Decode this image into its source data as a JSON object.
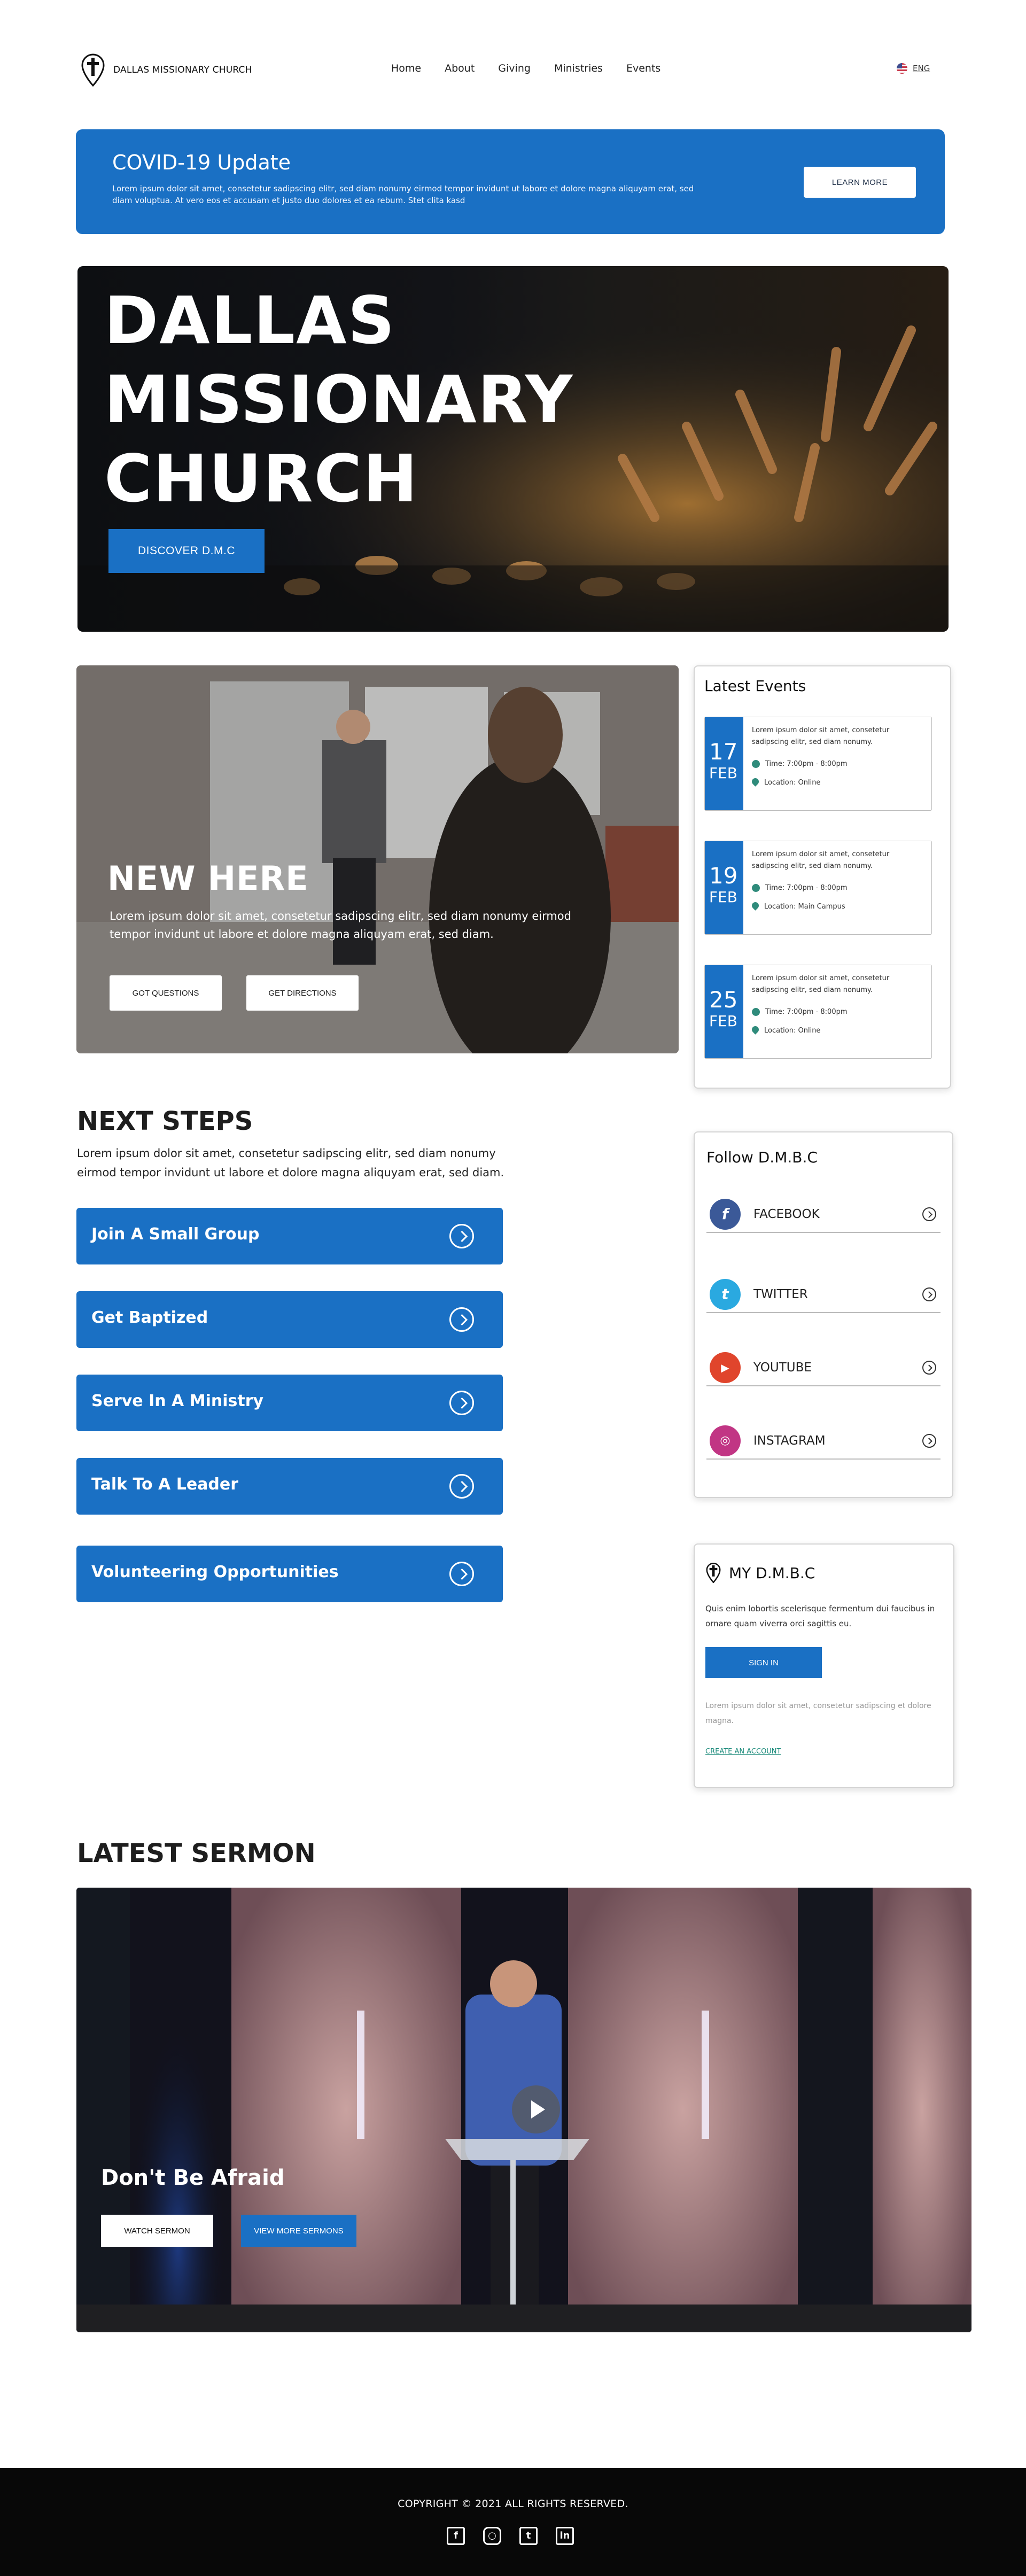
{
  "header": {
    "logo_text": "DALLAS MISSIONARY CHURCH",
    "nav": [
      "Home",
      "About",
      "Giving",
      "Ministries",
      "Events"
    ],
    "language": "ENG"
  },
  "covid": {
    "title": "COVID-19 Update",
    "text": "Lorem ipsum dolor sit amet, consetetur sadipscing elitr, sed diam nonumy eirmod tempor invidunt ut labore et dolore magna aliquyam erat, sed diam voluptua. At vero eos et accusam et justo duo dolores et ea rebum. Stet clita kasd",
    "button": "LEARN MORE"
  },
  "hero": {
    "title_lines": [
      "DALLAS",
      "MISSIONARY",
      "CHURCH"
    ],
    "button": "DISCOVER D.M.C"
  },
  "new_here": {
    "title": "NEW HERE",
    "text": "Lorem ipsum dolor sit amet, consetetur sadipscing elitr, sed diam nonumy eirmod tempor invidunt ut labore et dolore magna aliquyam erat, sed diam.",
    "btn_questions": "GOT QUESTIONS",
    "btn_directions": "GET DIRECTIONS"
  },
  "events": {
    "title": "Latest Events",
    "items": [
      {
        "day": "17",
        "month": "FEB",
        "desc": "Lorem ipsum dolor sit amet, consetetur sadipscing elitr, sed diam nonumy.",
        "time": "Time: 7:00pm - 8:00pm",
        "location": "Location: Online"
      },
      {
        "day": "19",
        "month": "FEB",
        "desc": "Lorem ipsum dolor sit amet, consetetur sadipscing elitr, sed diam nonumy.",
        "time": "Time: 7:00pm - 8:00pm",
        "location": "Location: Main Campus"
      },
      {
        "day": "25",
        "month": "FEB",
        "desc": "Lorem ipsum dolor sit amet, consetetur sadipscing elitr, sed diam nonumy.",
        "time": "Time: 7:00pm - 8:00pm",
        "location": "Location: Online"
      }
    ]
  },
  "next_steps": {
    "title": "NEXT STEPS",
    "text": "Lorem ipsum dolor sit amet, consetetur sadipscing elitr, sed diam nonumy eirmod tempor invidunt ut labore et dolore magna aliquyam erat, sed diam.",
    "items": [
      "Join A Small Group",
      "Get Baptized",
      "Serve In A Ministry",
      "Talk To A Leader",
      "Volunteering Opportunities"
    ]
  },
  "follow": {
    "title": "Follow D.M.B.C",
    "items": [
      {
        "label": "FACEBOOK",
        "icon": "facebook-icon",
        "color": "#3b5998"
      },
      {
        "label": "TWITTER",
        "icon": "twitter-icon",
        "color": "#2aa9e0"
      },
      {
        "label": "YOUTUBE",
        "icon": "youtube-icon",
        "color": "#e0452c"
      },
      {
        "label": "INSTAGRAM",
        "icon": "instagram-icon",
        "color": "#c13584"
      }
    ]
  },
  "my_dmbc": {
    "title": "MY D.M.B.C",
    "text": "Quis enim lobortis scelerisque fermentum dui faucibus in ornare quam viverra orci sagittis eu.",
    "button": "SIGN IN",
    "note": "Lorem ipsum dolor sit amet, consetetur sadipscing  et dolore magna.",
    "link": "CREATE AN ACCOUNT"
  },
  "sermon": {
    "section_title": "LATEST SERMON",
    "title": "Don't Be Afraid",
    "btn_watch": "WATCH SERMON",
    "btn_more": "VIEW MORE SERMONS"
  },
  "footer": {
    "copyright": "COPYRIGHT © 2021 ALL RIGHTS RESERVED."
  },
  "colors": {
    "brand_blue": "#1a70c4",
    "accent_teal": "#2f8b7b",
    "footer_bg": "#080808"
  }
}
